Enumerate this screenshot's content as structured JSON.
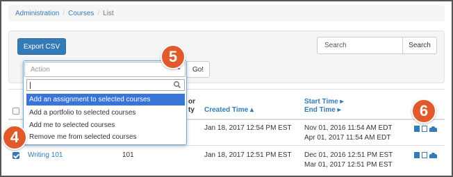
{
  "breadcrumb": {
    "items": [
      "Administration",
      "Courses"
    ],
    "current": "List"
  },
  "toolbar": {
    "export_label": "Export CSV",
    "search_placeholder": "Search",
    "search_button": "Search",
    "go_button": "Go!"
  },
  "action_dropdown": {
    "placeholder": "Action",
    "options": [
      "Add an assignment to selected courses",
      "Add a portfolio to selected courses",
      "Add me to selected courses",
      "Remove me from selected courses"
    ]
  },
  "table": {
    "headers": {
      "instructor_partial_1": "or",
      "instructor_partial_2": "ty",
      "created_time": "Created Time ▴",
      "start_time": "Start Time ▸",
      "end_time": "End Time ▸"
    },
    "rows": [
      {
        "checked": false,
        "name": "",
        "section": "",
        "created": "Jan 18, 2017 12:54 PM EST",
        "start": "Nov 01, 2016 11:54 AM EDT",
        "end": "Apr 01, 2017 11:54 AM EDT"
      },
      {
        "checked": true,
        "name": "Writing 101",
        "section": "101",
        "created": "Jan 18, 2017 12:51 PM EST",
        "start": "Dec 01, 2016 12:51 PM EST",
        "end": "Mar 01, 2017 12:51 PM EST"
      }
    ]
  },
  "callouts": [
    "5",
    "4",
    "6"
  ],
  "colors": {
    "primary": "#337ab7",
    "highlight": "#3875d7",
    "badge": "#e05a2b"
  },
  "icons": [
    "file-icon",
    "edit-icon",
    "users-icon"
  ]
}
